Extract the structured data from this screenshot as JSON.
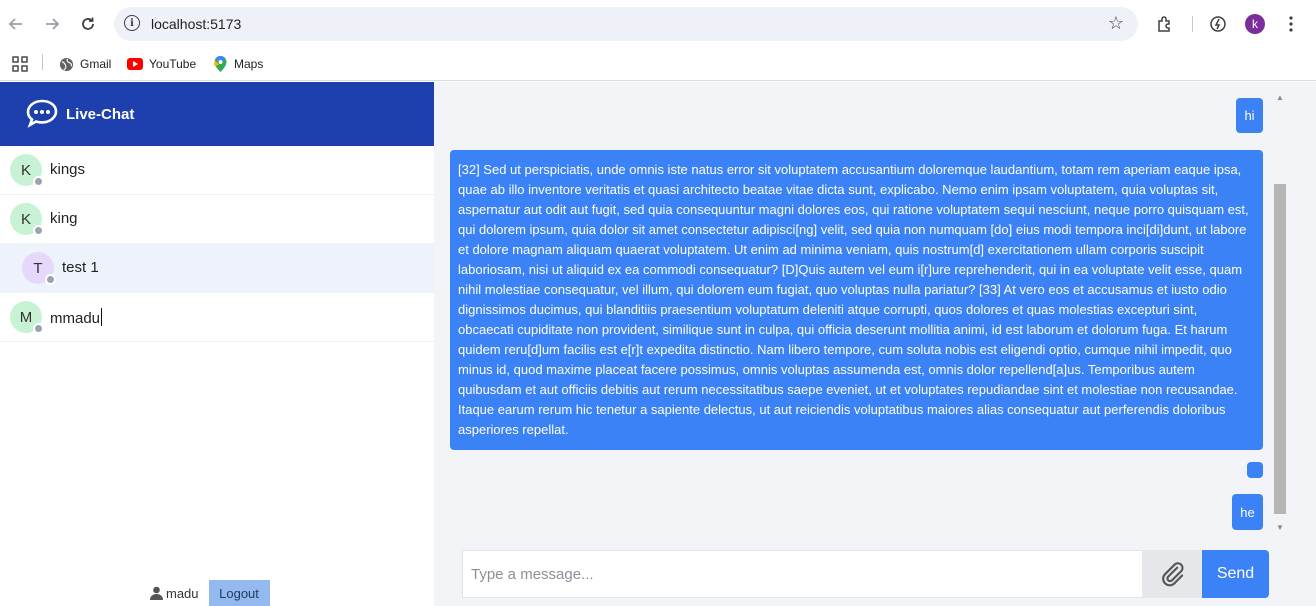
{
  "browser": {
    "url": "localhost:5173",
    "profile_initial": "k",
    "bookmarks": [
      "Gmail",
      "YouTube",
      "Maps"
    ]
  },
  "app": {
    "brand": "Live-Chat",
    "contacts": [
      {
        "initial": "K",
        "name": "kings",
        "avatar_color": "#c8f2d4"
      },
      {
        "initial": "K",
        "name": "king",
        "avatar_color": "#c8f2d4"
      },
      {
        "initial": "T",
        "name": "test 1",
        "avatar_color": "#e6d8fa"
      },
      {
        "initial": "M",
        "name": "mmadu",
        "avatar_color": "#c8f2d4"
      }
    ],
    "current_user": "madu",
    "logout_label": "Logout"
  },
  "chat": {
    "messages": [
      {
        "text": "hi"
      },
      {
        "text": "[32] Sed ut perspiciatis, unde omnis iste natus error sit voluptatem accusantium doloremque laudantium, totam rem aperiam eaque ipsa, quae ab illo inventore veritatis et quasi architecto beatae vitae dicta sunt, explicabo. Nemo enim ipsam voluptatem, quia voluptas sit, aspernatur aut odit aut fugit, sed quia consequuntur magni dolores eos, qui ratione voluptatem sequi nesciunt, neque porro quisquam est, qui dolorem ipsum, quia dolor sit amet consectetur adipisci[ng] velit, sed quia non numquam [do] eius modi tempora inci[di]dunt, ut labore et dolore magnam aliquam quaerat voluptatem. Ut enim ad minima veniam, quis nostrum[d] exercitationem ullam corporis suscipit laboriosam, nisi ut aliquid ex ea commodi consequatur? [D]Quis autem vel eum i[r]ure reprehenderit, qui in ea voluptate velit esse, quam nihil molestiae consequatur, vel illum, qui dolorem eum fugiat, quo voluptas nulla pariatur? [33] At vero eos et accusamus et iusto odio dignissimos ducimus, qui blanditiis praesentium voluptatum deleniti atque corrupti, quos dolores et quas molestias excepturi sint, obcaecati cupiditate non provident, similique sunt in culpa, qui officia deserunt mollitia animi, id est laborum et dolorum fuga. Et harum quidem reru[d]um facilis est e[r]t expedita distinctio. Nam libero tempore, cum soluta nobis est eligendi optio, cumque nihil impedit, quo minus id, quod maxime placeat facere possimus, omnis voluptas assumenda est, omnis dolor repellend[a]us. Temporibus autem quibusdam et aut officiis debitis aut rerum necessitatibus saepe eveniet, ut et voluptates repudiandae sint et molestiae non recusandae. Itaque earum rerum hic tenetur a sapiente delectus, ut aut reiciendis voluptatibus maiores alias consequatur aut perferendis doloribus asperiores repellat."
      },
      {
        "text": ""
      },
      {
        "text": "he"
      }
    ],
    "input_placeholder": "Type a message...",
    "send_label": "Send"
  },
  "colors": {
    "brand_bar": "#1e40af",
    "bubble": "#3b82f6",
    "chat_bg": "#f3f4f8",
    "logout_bg": "#93b9ee"
  }
}
